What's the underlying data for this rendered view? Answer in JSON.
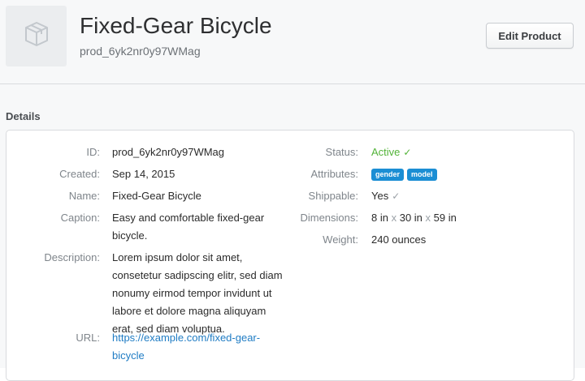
{
  "header": {
    "title": "Fixed-Gear Bicycle",
    "subtitle": "prod_6yk2nr0y97WMag",
    "edit_label": "Edit Product",
    "thumb_icon": "package-icon"
  },
  "details": {
    "section_title": "Details",
    "left": {
      "id_label": "ID:",
      "id_value": "prod_6yk2nr0y97WMag",
      "created_label": "Created:",
      "created_value": "Sep 14, 2015",
      "name_label": "Name:",
      "name_value": "Fixed-Gear Bicycle",
      "caption_label": "Caption:",
      "caption_line1": "Easy and comfortable fixed-gear",
      "caption_line2": "bicycle.",
      "description_label": "Description:",
      "description_lines": [
        "Lorem ipsum dolor sit amet,",
        "consetetur sadipscing elitr, sed diam",
        "nonumy eirmod tempor invidunt ut",
        "labore et dolore magna aliquyam",
        "erat, sed diam voluptua."
      ],
      "url_label": "URL:",
      "url_line1": "https://example.com/fixed-gear-",
      "url_line2": "bicycle"
    },
    "right": {
      "status_label": "Status:",
      "status_value": "Active",
      "attributes_label": "Attributes:",
      "attributes": [
        "gender",
        "model"
      ],
      "shippable_label": "Shippable:",
      "shippable_value": "Yes",
      "dimensions_label": "Dimensions:",
      "dim_length": "8 in",
      "dim_width": "30 in",
      "dim_height": "59 in",
      "dim_separator": "x",
      "weight_label": "Weight:",
      "weight_value": "240 ounces"
    }
  },
  "colors": {
    "active": "#52b338",
    "badge": "#1b8ed4",
    "link": "#1f7cc4"
  }
}
